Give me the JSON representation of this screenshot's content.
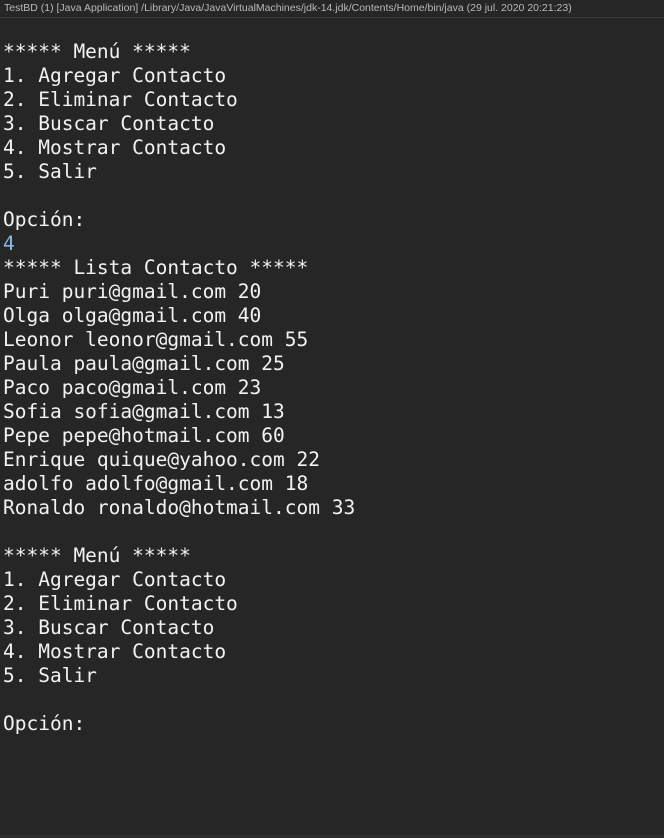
{
  "window": {
    "title": "TestBD (1) [Java Application] /Library/Java/JavaVirtualMachines/jdk-14.jdk/Contents/Home/bin/java  (29 jul. 2020 20:21:23)"
  },
  "colors": {
    "background": "#262626",
    "output_text": "#f2f2f2",
    "user_input_text": "#8cb8e8"
  },
  "console": {
    "lines": [
      {
        "text": "***** Menú *****",
        "type": "output"
      },
      {
        "text": "1. Agregar Contacto",
        "type": "output"
      },
      {
        "text": "2. Eliminar Contacto",
        "type": "output"
      },
      {
        "text": "3. Buscar Contacto",
        "type": "output"
      },
      {
        "text": "4. Mostrar Contacto",
        "type": "output"
      },
      {
        "text": "5. Salir",
        "type": "output"
      },
      {
        "text": "",
        "type": "output"
      },
      {
        "text": "Opción:",
        "type": "output"
      },
      {
        "text": "4",
        "type": "input"
      },
      {
        "text": "***** Lista Contacto *****",
        "type": "output"
      },
      {
        "text": "Puri puri@gmail.com 20",
        "type": "output"
      },
      {
        "text": "Olga olga@gmail.com 40",
        "type": "output"
      },
      {
        "text": "Leonor leonor@gmail.com 55",
        "type": "output"
      },
      {
        "text": "Paula paula@gmail.com 25",
        "type": "output"
      },
      {
        "text": "Paco paco@gmail.com 23",
        "type": "output"
      },
      {
        "text": "Sofia sofia@gmail.com 13",
        "type": "output"
      },
      {
        "text": "Pepe pepe@hotmail.com 60",
        "type": "output"
      },
      {
        "text": "Enrique quique@yahoo.com 22",
        "type": "output"
      },
      {
        "text": "adolfo adolfo@gmail.com 18",
        "type": "output"
      },
      {
        "text": "Ronaldo ronaldo@hotmail.com 33",
        "type": "output"
      },
      {
        "text": "",
        "type": "output"
      },
      {
        "text": "***** Menú *****",
        "type": "output"
      },
      {
        "text": "1. Agregar Contacto",
        "type": "output"
      },
      {
        "text": "2. Eliminar Contacto",
        "type": "output"
      },
      {
        "text": "3. Buscar Contacto",
        "type": "output"
      },
      {
        "text": "4. Mostrar Contacto",
        "type": "output"
      },
      {
        "text": "5. Salir",
        "type": "output"
      },
      {
        "text": "",
        "type": "output"
      },
      {
        "text": "Opción:",
        "type": "output"
      }
    ]
  }
}
